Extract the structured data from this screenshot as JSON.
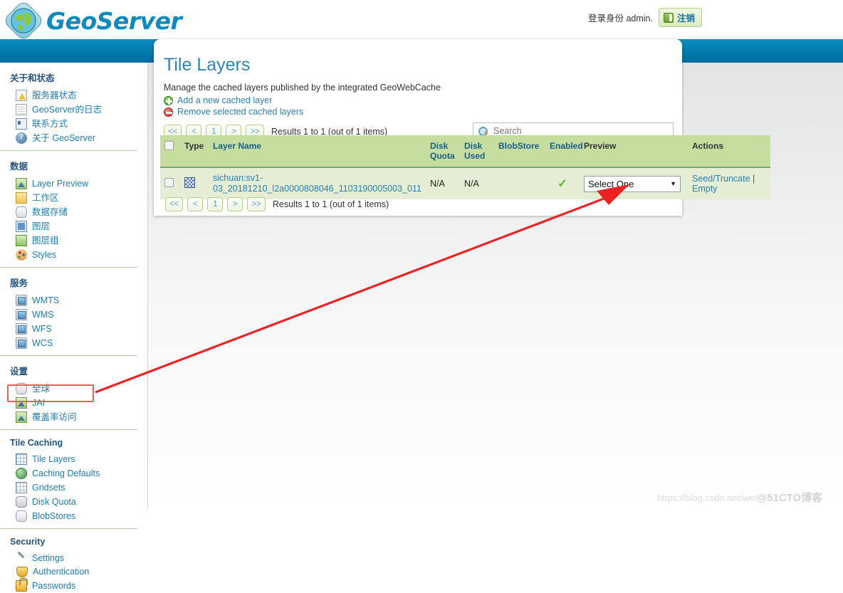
{
  "header": {
    "brand": "GeoServer",
    "logo_icon": "globe-icon",
    "login_text": "登录身份 admin.",
    "logout_label": "注销",
    "logout_icon": "logout-door-icon"
  },
  "sidebar": {
    "groups": [
      {
        "title": "关于和状态",
        "items": [
          {
            "label": "服务器状态",
            "icon": "server-status-icon"
          },
          {
            "label": "GeoServer的日志",
            "icon": "log-document-icon"
          },
          {
            "label": "联系方式",
            "icon": "contact-card-icon"
          },
          {
            "label": "关于 GeoServer",
            "icon": "about-info-icon"
          }
        ]
      },
      {
        "title": "数据",
        "items": [
          {
            "label": "Layer Preview",
            "icon": "layer-preview-icon"
          },
          {
            "label": "工作区",
            "icon": "workspace-folder-icon"
          },
          {
            "label": "数据存储",
            "icon": "datastore-icon"
          },
          {
            "label": "图层",
            "icon": "layer-icon"
          },
          {
            "label": "图层组",
            "icon": "layer-group-icon"
          },
          {
            "label": "Styles",
            "icon": "styles-palette-icon"
          }
        ]
      },
      {
        "title": "服务",
        "items": [
          {
            "label": "WMTS",
            "icon": "service-wmts-icon"
          },
          {
            "label": "WMS",
            "icon": "service-wms-icon"
          },
          {
            "label": "WFS",
            "icon": "service-wfs-icon"
          },
          {
            "label": "WCS",
            "icon": "service-wcs-icon"
          }
        ]
      },
      {
        "title": "设置",
        "items": [
          {
            "label": "全球",
            "icon": "global-settings-icon"
          },
          {
            "label": "JAI",
            "icon": "jai-icon"
          },
          {
            "label": "覆盖率访问",
            "icon": "coverage-access-icon"
          }
        ]
      },
      {
        "title": "Tile Caching",
        "items": [
          {
            "label": "Tile Layers",
            "icon": "tile-layers-icon",
            "highlighted": true
          },
          {
            "label": "Caching Defaults",
            "icon": "caching-defaults-icon"
          },
          {
            "label": "Gridsets",
            "icon": "gridsets-icon"
          },
          {
            "label": "Disk Quota",
            "icon": "disk-quota-icon"
          },
          {
            "label": "BlobStores",
            "icon": "blobstores-icon"
          }
        ]
      },
      {
        "title": "Security",
        "items": [
          {
            "label": "Settings",
            "icon": "wrench-icon"
          },
          {
            "label": "Authentication",
            "icon": "shield-icon"
          },
          {
            "label": "Passwords",
            "icon": "lock-icon"
          }
        ]
      }
    ]
  },
  "panel": {
    "title": "Tile Layers",
    "description": "Manage the cached layers published by the integrated GeoWebCache",
    "actions": [
      {
        "label": "Add a new cached layer",
        "icon": "add-circle-icon"
      },
      {
        "label": "Remove selected cached layers",
        "icon": "remove-circle-icon"
      }
    ]
  },
  "pager": {
    "first": "<<",
    "prev": "<",
    "page": "1",
    "next": ">",
    "last": ">>",
    "results_text": "Results 1 to 1 (out of 1 items)"
  },
  "search": {
    "placeholder": "Search",
    "value": "",
    "icon": "search-icon"
  },
  "table": {
    "columns": [
      {
        "key": "select",
        "label": ""
      },
      {
        "key": "type",
        "label": "Type"
      },
      {
        "key": "layer_name",
        "label": "Layer Name"
      },
      {
        "key": "disk_quota",
        "label": "Disk Quota"
      },
      {
        "key": "disk_used",
        "label": "Disk Used"
      },
      {
        "key": "blobstore",
        "label": "BlobStore"
      },
      {
        "key": "enabled",
        "label": "Enabled"
      },
      {
        "key": "preview",
        "label": "Preview"
      },
      {
        "key": "actions",
        "label": "Actions"
      }
    ],
    "rows": [
      {
        "type_icon": "raster-tile-icon",
        "layer_name": "sichuan:sv1-03_20181210_l2a0000808046_1103190005003_011",
        "disk_quota": "N/A",
        "disk_used": "N/A",
        "blobstore": "",
        "enabled_icon": "green-check-icon",
        "preview_value": "Select One",
        "action_seed": "Seed/Truncate",
        "action_sep": "|",
        "action_empty": "Empty"
      }
    ]
  },
  "annotation": {
    "arrow_color": "#ee2222",
    "highlight_color": "#f05b5b"
  },
  "watermark": {
    "text1": "https://blog.csdn.net/wei",
    "text2": "@51CTO博客"
  },
  "colors": {
    "brand_blue": "#0d8bc1",
    "band_blue": "#0077a8",
    "link_blue": "#2b7fb5",
    "table_header_green": "#c5dd9e",
    "table_row_green": "#e3eed4",
    "heading_navy": "#24537d"
  }
}
